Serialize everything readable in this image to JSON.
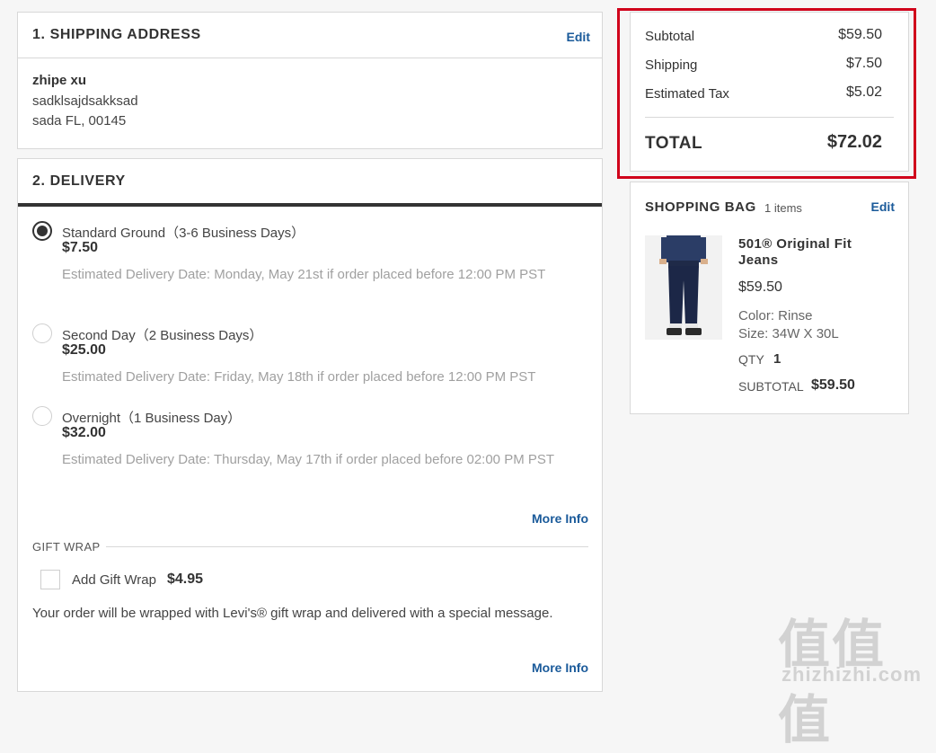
{
  "shipping_address": {
    "heading": "1.  SHIPPING ADDRESS",
    "edit_label": "Edit",
    "name": "zhipe xu",
    "line1": "sadklsajdsakksad",
    "line2": "sada FL, 00145"
  },
  "delivery": {
    "heading": "2. DELIVERY",
    "options": [
      {
        "label": "Standard Ground（3-6 Business Days）",
        "price": "$7.50",
        "estimate": "Estimated Delivery Date: Monday, May 21st if order placed before 12:00 PM PST",
        "selected": true
      },
      {
        "label": "Second Day（2 Business Days）",
        "price": "$25.00",
        "estimate": "Estimated Delivery Date: Friday, May 18th if order placed before 12:00 PM PST",
        "selected": false
      },
      {
        "label": "Overnight（1 Business Day）",
        "price": "$32.00",
        "estimate": "Estimated Delivery Date: Thursday, May 17th if order placed before 02:00 PM PST",
        "selected": false
      }
    ],
    "more_info_label": "More Info",
    "gift_wrap_heading": "GIFT WRAP",
    "gift_wrap_label": "Add Gift Wrap",
    "gift_wrap_price": "$4.95",
    "gift_wrap_description": "Your order will be wrapped with Levi's® gift wrap and delivered with a special message.",
    "gift_more_info_label": "More Info"
  },
  "summary": {
    "subtotal_label": "Subtotal",
    "subtotal_value": "$59.50",
    "shipping_label": "Shipping",
    "shipping_value": "$7.50",
    "tax_label": "Estimated Tax",
    "tax_value": "$5.02",
    "total_label": "TOTAL",
    "total_value": "$72.02",
    "highlight_color": "#d0021b"
  },
  "bag": {
    "heading": "SHOPPING BAG",
    "count": "1 items",
    "edit_label": "Edit",
    "item": {
      "name": "501® Original Fit Jeans",
      "price": "$59.50",
      "color": "Color: Rinse",
      "size": "Size: 34W X 30L",
      "qty_label": "QTY",
      "qty_value": "1",
      "subtotal_label": "SUBTOTAL",
      "subtotal_value": "$59.50"
    }
  },
  "watermark": {
    "glyphs": "值值值",
    "domain": "zhizhizhi.com"
  }
}
